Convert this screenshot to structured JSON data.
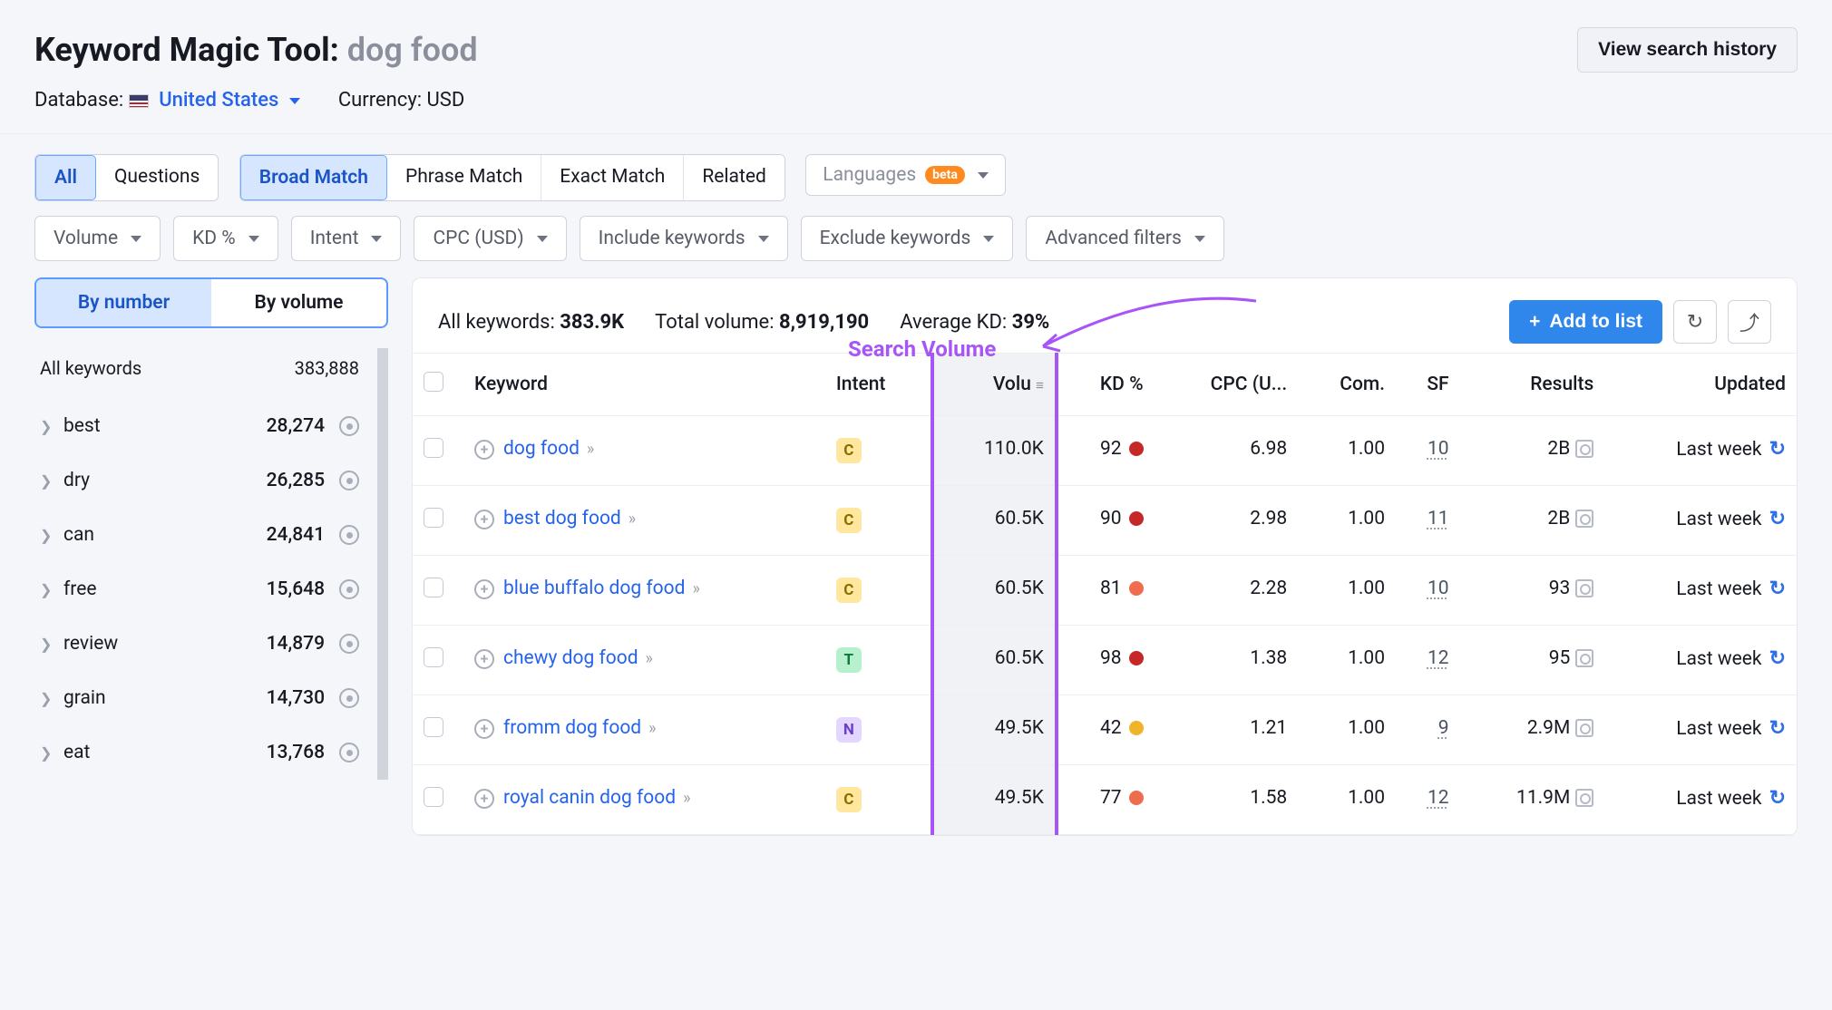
{
  "header": {
    "title_prefix": "Keyword Magic Tool:",
    "query": "dog food",
    "history_btn": "View search history",
    "database_label": "Database:",
    "country": "United States",
    "currency_label": "Currency: USD"
  },
  "tabs1": {
    "all": "All",
    "questions": "Questions"
  },
  "tabs2": {
    "broad": "Broad Match",
    "phrase": "Phrase Match",
    "exact": "Exact Match",
    "related": "Related"
  },
  "lang_dd": {
    "label": "Languages",
    "badge": "beta"
  },
  "filters": [
    "Volume",
    "KD %",
    "Intent",
    "CPC (USD)",
    "Include keywords",
    "Exclude keywords",
    "Advanced filters"
  ],
  "sort_tabs": {
    "number": "By number",
    "volume": "By volume"
  },
  "sidebar": {
    "all_label": "All keywords",
    "all_count": "383,888",
    "items": [
      {
        "label": "best",
        "count": "28,274"
      },
      {
        "label": "dry",
        "count": "26,285"
      },
      {
        "label": "can",
        "count": "24,841"
      },
      {
        "label": "free",
        "count": "15,648"
      },
      {
        "label": "review",
        "count": "14,879"
      },
      {
        "label": "grain",
        "count": "14,730"
      },
      {
        "label": "eat",
        "count": "13,768"
      }
    ]
  },
  "stats": {
    "all_kw_label": "All keywords:",
    "all_kw_value": "383.9K",
    "total_vol_label": "Total volume:",
    "total_vol_value": "8,919,190",
    "avg_kd_label": "Average KD:",
    "avg_kd_value": "39%",
    "add_btn": "Add to list"
  },
  "annotation": "Search Volume",
  "columns": {
    "keyword": "Keyword",
    "intent": "Intent",
    "volume": "Volu",
    "kd": "KD %",
    "cpc": "CPC (U...",
    "com": "Com.",
    "sf": "SF",
    "results": "Results",
    "updated": "Updated"
  },
  "rows": [
    {
      "keyword": "dog food",
      "intent": "C",
      "volume": "110.0K",
      "kd": "92",
      "kd_color": "kd-red",
      "cpc": "6.98",
      "com": "1.00",
      "sf": "10",
      "results": "2B",
      "updated": "Last week"
    },
    {
      "keyword": "best dog food",
      "intent": "C",
      "volume": "60.5K",
      "kd": "90",
      "kd_color": "kd-red",
      "cpc": "2.98",
      "com": "1.00",
      "sf": "11",
      "results": "2B",
      "updated": "Last week"
    },
    {
      "keyword": "blue buffalo dog food",
      "intent": "C",
      "volume": "60.5K",
      "kd": "81",
      "kd_color": "kd-orange",
      "cpc": "2.28",
      "com": "1.00",
      "sf": "10",
      "results": "93",
      "updated": "Last week"
    },
    {
      "keyword": "chewy dog food",
      "intent": "T",
      "volume": "60.5K",
      "kd": "98",
      "kd_color": "kd-red",
      "cpc": "1.38",
      "com": "1.00",
      "sf": "12",
      "results": "95",
      "updated": "Last week"
    },
    {
      "keyword": "fromm dog food",
      "intent": "N",
      "volume": "49.5K",
      "kd": "42",
      "kd_color": "kd-yellow",
      "cpc": "1.21",
      "com": "1.00",
      "sf": "9",
      "results": "2.9M",
      "updated": "Last week"
    },
    {
      "keyword": "royal canin dog food",
      "intent": "C",
      "volume": "49.5K",
      "kd": "77",
      "kd_color": "kd-orange",
      "cpc": "1.58",
      "com": "1.00",
      "sf": "12",
      "results": "11.9M",
      "updated": "Last week"
    }
  ]
}
